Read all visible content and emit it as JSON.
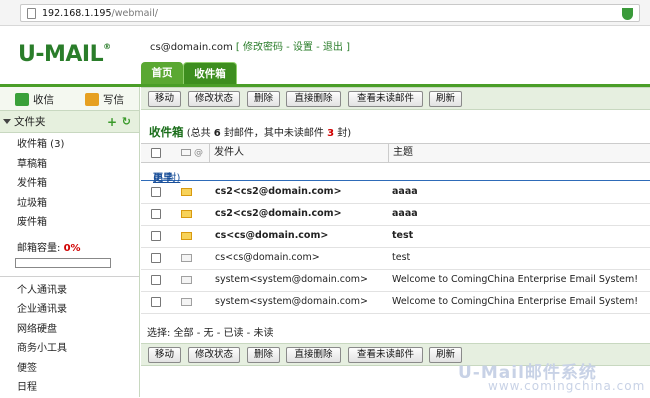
{
  "browser": {
    "url_host": "192.168.1.195",
    "url_path": "/webmail/"
  },
  "app": {
    "logo": "U-MAIL",
    "logo_mark": "®"
  },
  "header": {
    "user": "cs@domain.com",
    "links": "[ 修改密码 - 设置 - 退出 ]"
  },
  "tabs": [
    {
      "label": "首页"
    },
    {
      "label": "收件箱"
    }
  ],
  "sidebar": {
    "receive_label": "收信",
    "write_label": "写信",
    "folder_header": "文件夹",
    "folders": [
      {
        "label": "收件箱 (3)"
      },
      {
        "label": "草稿箱"
      },
      {
        "label": "发件箱"
      },
      {
        "label": "垃圾箱"
      },
      {
        "label": "废件箱"
      }
    ],
    "quota_label": "邮箱容量:",
    "quota_value": "0%",
    "quota_fraction": 0,
    "tools": [
      {
        "label": "个人通讯录"
      },
      {
        "label": "企业通讯录"
      },
      {
        "label": "网络硬盘"
      },
      {
        "label": "商务小工具"
      },
      {
        "label": "便签"
      },
      {
        "label": "日程"
      }
    ]
  },
  "toolbar": {
    "move": "移动",
    "status": "修改状态",
    "delete": "删除",
    "delete_direct": "直接删除",
    "view_unread": "查看未读邮件",
    "refresh": "刷新"
  },
  "list": {
    "title": "收件箱",
    "summary_pre": "(总共",
    "total": "6",
    "summary_mid": "封邮件，其中未读邮件",
    "unread": "3",
    "summary_post": "封)",
    "col_sender": "发件人",
    "col_subject": "主题",
    "group_label": "更早",
    "group_count": "(6 封)",
    "rows": [
      {
        "sender": "cs2<cs2@domain.com>",
        "subject": "aaaa",
        "unread": true
      },
      {
        "sender": "cs2<cs2@domain.com>",
        "subject": "aaaa",
        "unread": true
      },
      {
        "sender": "cs<cs@domain.com>",
        "subject": "test",
        "unread": true
      },
      {
        "sender": "cs<cs@domain.com>",
        "subject": "test",
        "unread": false
      },
      {
        "sender": "system<system@domain.com>",
        "subject": "Welcome to ComingChina Enterprise Email System!",
        "unread": false
      },
      {
        "sender": "system<system@domain.com>",
        "subject": "Welcome to ComingChina Enterprise Email System!",
        "unread": false
      }
    ],
    "select_bar": "选择:  全部 - 无 - 已读 - 未读"
  },
  "watermark": {
    "line1": "U-Mail邮件系统",
    "line2": "www.comingchina.com"
  },
  "colors": {
    "brand_green": "#2a7d2a",
    "tab_green": "#3d8e1f",
    "unread_red": "#d00000"
  }
}
